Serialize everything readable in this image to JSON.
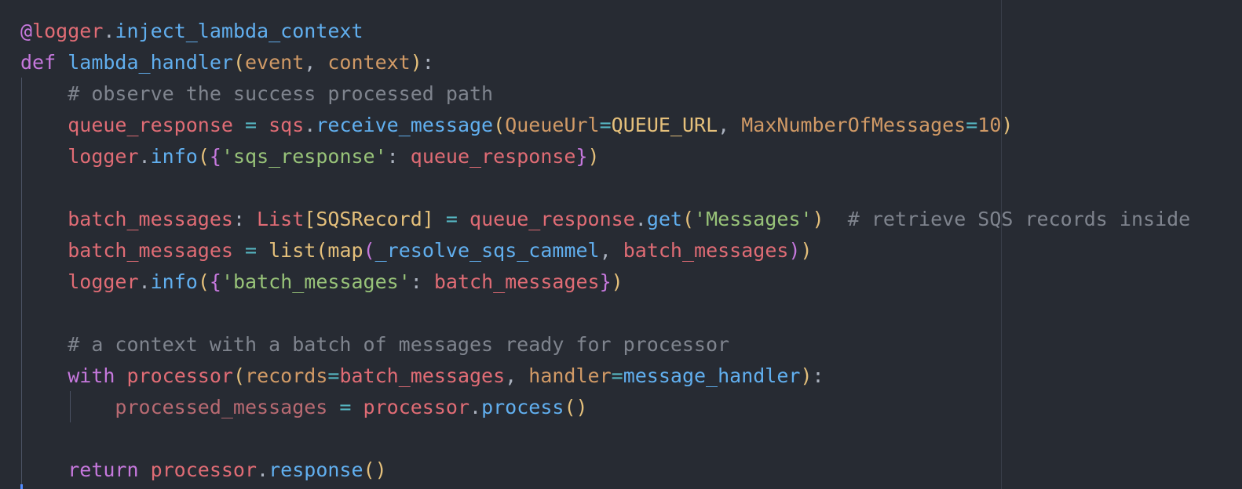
{
  "code": {
    "language": "python",
    "lines": [
      [
        [
          "kw",
          "@"
        ],
        [
          "var",
          "logger"
        ],
        [
          "pun",
          "."
        ],
        [
          "fn",
          "inject_lambda_context"
        ]
      ],
      [
        [
          "kw",
          "def "
        ],
        [
          "fn",
          "lambda_handler"
        ],
        [
          "br1",
          "("
        ],
        [
          "par",
          "event"
        ],
        [
          "pun",
          ", "
        ],
        [
          "par",
          "context"
        ],
        [
          "br1",
          ")"
        ],
        [
          "pun",
          ":"
        ]
      ],
      [
        [
          "pun",
          "    "
        ],
        [
          "cmt",
          "# observe the success processed path"
        ]
      ],
      [
        [
          "pun",
          "    "
        ],
        [
          "var",
          "queue_response"
        ],
        [
          "pun",
          " "
        ],
        [
          "op",
          "="
        ],
        [
          "pun",
          " "
        ],
        [
          "var",
          "sqs"
        ],
        [
          "pun",
          "."
        ],
        [
          "fn",
          "receive_message"
        ],
        [
          "br1",
          "("
        ],
        [
          "par",
          "QueueUrl"
        ],
        [
          "op",
          "="
        ],
        [
          "cls",
          "QUEUE_URL"
        ],
        [
          "pun",
          ", "
        ],
        [
          "par",
          "MaxNumberOfMessages"
        ],
        [
          "op",
          "="
        ],
        [
          "num",
          "10"
        ],
        [
          "br1",
          ")"
        ]
      ],
      [
        [
          "pun",
          "    "
        ],
        [
          "var",
          "logger"
        ],
        [
          "pun",
          "."
        ],
        [
          "fn",
          "info"
        ],
        [
          "br1",
          "("
        ],
        [
          "br2",
          "{"
        ],
        [
          "str",
          "'sqs_response'"
        ],
        [
          "pun",
          ": "
        ],
        [
          "var",
          "queue_response"
        ],
        [
          "br2",
          "}"
        ],
        [
          "br1",
          ")"
        ]
      ],
      [],
      [
        [
          "pun",
          "    "
        ],
        [
          "var",
          "batch_messages"
        ],
        [
          "pun",
          ": "
        ],
        [
          "var",
          "List"
        ],
        [
          "br1",
          "["
        ],
        [
          "cls",
          "SQSRecord"
        ],
        [
          "br1",
          "]"
        ],
        [
          "pun",
          " "
        ],
        [
          "op",
          "="
        ],
        [
          "pun",
          " "
        ],
        [
          "var",
          "queue_response"
        ],
        [
          "pun",
          "."
        ],
        [
          "fn",
          "get"
        ],
        [
          "br1",
          "("
        ],
        [
          "str",
          "'Messages'"
        ],
        [
          "br1",
          ")"
        ],
        [
          "pun",
          "  "
        ],
        [
          "cmt",
          "# retrieve SQS records inside"
        ]
      ],
      [
        [
          "pun",
          "    "
        ],
        [
          "var",
          "batch_messages"
        ],
        [
          "pun",
          " "
        ],
        [
          "op",
          "="
        ],
        [
          "pun",
          " "
        ],
        [
          "cls",
          "list"
        ],
        [
          "br1",
          "("
        ],
        [
          "cls",
          "map"
        ],
        [
          "br2",
          "("
        ],
        [
          "fn",
          "_resolve_sqs_cammel"
        ],
        [
          "pun",
          ", "
        ],
        [
          "var",
          "batch_messages"
        ],
        [
          "br2",
          ")"
        ],
        [
          "br1",
          ")"
        ]
      ],
      [
        [
          "pun",
          "    "
        ],
        [
          "var",
          "logger"
        ],
        [
          "pun",
          "."
        ],
        [
          "fn",
          "info"
        ],
        [
          "br1",
          "("
        ],
        [
          "br2",
          "{"
        ],
        [
          "str",
          "'batch_messages'"
        ],
        [
          "pun",
          ": "
        ],
        [
          "var",
          "batch_messages"
        ],
        [
          "br2",
          "}"
        ],
        [
          "br1",
          ")"
        ]
      ],
      [],
      [
        [
          "pun",
          "    "
        ],
        [
          "cmt",
          "# a context with a batch of messages ready for processor"
        ]
      ],
      [
        [
          "pun",
          "    "
        ],
        [
          "kw",
          "with "
        ],
        [
          "var",
          "processor"
        ],
        [
          "br1",
          "("
        ],
        [
          "par",
          "records"
        ],
        [
          "op",
          "="
        ],
        [
          "var",
          "batch_messages"
        ],
        [
          "pun",
          ", "
        ],
        [
          "par",
          "handler"
        ],
        [
          "op",
          "="
        ],
        [
          "fn",
          "message_handler"
        ],
        [
          "br1",
          ")"
        ],
        [
          "pun",
          ":"
        ]
      ],
      [
        [
          "pun",
          "        "
        ],
        [
          "dim",
          "processed_messages"
        ],
        [
          "pun",
          " "
        ],
        [
          "op",
          "="
        ],
        [
          "pun",
          " "
        ],
        [
          "var",
          "processor"
        ],
        [
          "pun",
          "."
        ],
        [
          "fn",
          "process"
        ],
        [
          "br1",
          "()"
        ]
      ],
      [],
      [
        [
          "pun",
          "    "
        ],
        [
          "kw",
          "return "
        ],
        [
          "var",
          "processor"
        ],
        [
          "pun",
          "."
        ],
        [
          "fn",
          "response"
        ],
        [
          "br1",
          "()"
        ]
      ]
    ]
  }
}
